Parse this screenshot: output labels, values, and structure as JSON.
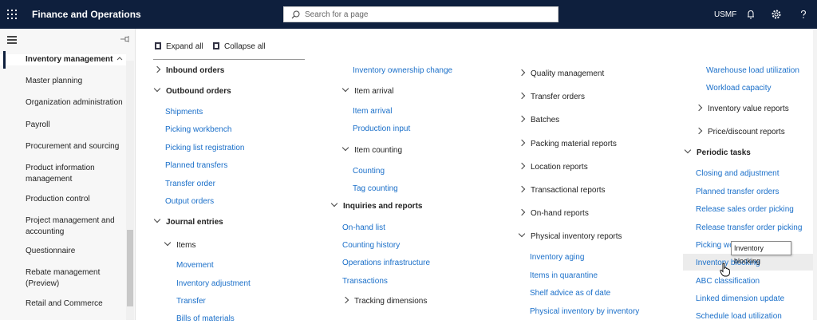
{
  "header": {
    "app_title": "Finance and Operations",
    "search_placeholder": "Search for a page",
    "company": "USMF"
  },
  "sidebar": {
    "items": [
      {
        "label": "Inventory management"
      },
      {
        "label": "Master planning"
      },
      {
        "label": "Organization administration"
      },
      {
        "label": "Payroll"
      },
      {
        "label": "Procurement and sourcing"
      },
      {
        "label": "Product information management"
      },
      {
        "label": "Production control"
      },
      {
        "label": "Project management and accounting"
      },
      {
        "label": "Questionnaire"
      },
      {
        "label": "Rebate management (Preview)"
      },
      {
        "label": "Retail and Commerce"
      }
    ]
  },
  "toolbar": {
    "expand_all": "Expand all",
    "collapse_all": "Collapse all"
  },
  "col1": {
    "inbound_orders": "Inbound orders",
    "outbound_orders": "Outbound orders",
    "shipments": "Shipments",
    "picking_workbench": "Picking workbench",
    "picking_list_registration": "Picking list registration",
    "planned_transfers": "Planned transfers",
    "transfer_order": "Transfer order",
    "output_orders": "Output orders",
    "journal_entries": "Journal entries",
    "items": "Items",
    "movement": "Movement",
    "inventory_adjustment": "Inventory adjustment",
    "transfer": "Transfer",
    "bills_of_materials": "Bills of materials"
  },
  "col2": {
    "inventory_ownership_change": "Inventory ownership change",
    "item_arrival_group": "Item arrival",
    "item_arrival": "Item arrival",
    "production_input": "Production input",
    "item_counting": "Item counting",
    "counting": "Counting",
    "tag_counting": "Tag counting",
    "inquiries_and_reports": "Inquiries and reports",
    "on_hand_list": "On-hand list",
    "counting_history": "Counting history",
    "operations_infrastructure": "Operations infrastructure",
    "transactions": "Transactions",
    "tracking_dimensions": "Tracking dimensions"
  },
  "col3": {
    "quality_management": "Quality management",
    "transfer_orders": "Transfer orders",
    "batches": "Batches",
    "packing_material_reports": "Packing material reports",
    "location_reports": "Location reports",
    "transactional_reports": "Transactional reports",
    "on_hand_reports": "On-hand reports",
    "physical_inventory_reports": "Physical inventory reports",
    "inventory_aging": "Inventory aging",
    "items_in_quarantine": "Items in quarantine",
    "shelf_advice": "Shelf advice as of date",
    "physical_inventory_by_dimension": "Physical inventory by inventory"
  },
  "col4": {
    "warehouse_load_utilization": "Warehouse load utilization",
    "workload_capacity": "Workload capacity",
    "inventory_value_reports": "Inventory value reports",
    "price_discount_reports": "Price/discount reports",
    "periodic_tasks": "Periodic tasks",
    "closing_and_adjustment": "Closing and adjustment",
    "planned_transfer_orders": "Planned transfer orders",
    "release_sales_order_picking": "Release sales order picking",
    "release_transfer_order_picking": "Release transfer order picking",
    "picking_workbench_partial": "Picking wo",
    "inventory_blocking": "Inventory blocking",
    "abc_classification": "ABC classification",
    "linked_dimension_update": "Linked dimension update",
    "schedule_load_utilization": "Schedule load utilization"
  },
  "tooltip": "Inventory blocking"
}
